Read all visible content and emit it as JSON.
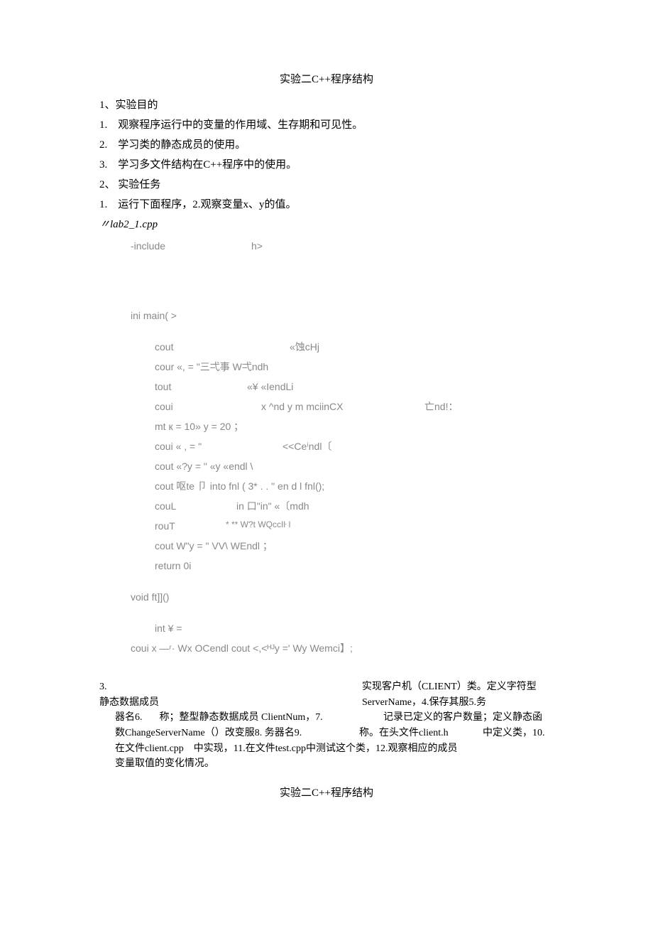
{
  "title": "实验二C++程序结构",
  "intro": {
    "h1": "1、实验目的",
    "p1": "1.　观察程序运行中的变量的作用域、生存期和可见性。",
    "p2": "2.　学习类的静态成员的使用。",
    "p3": "3.　学习多文件结构在C++程序中的使用。",
    "h2": "2、 实验任务",
    "t1": "1.　运行下面程序，2.观察变量x、y的值。",
    "file": "〃lab2_1.cpp"
  },
  "code": {
    "l1a": "-include",
    "l1b": "h>",
    "l2": "ini main( >",
    "l3a": "cout",
    "l3b": "«蚀cHj",
    "l4": "cour «, = \"三弌事 W弌ndh",
    "l5a": "tout",
    "l5b": "«¥ «IendLi",
    "l6a": "coui",
    "l6b": "x ^nd y m mciinCX",
    "l6c": "亡nd!：",
    "l7": "mt к = 10» y = 20 ；",
    "l8a": "coui « , = \"",
    "l8b": "<<Ceⁱndl〔",
    "l9": "cout «?y = \" «y «endl \\",
    "l10": "cout 呕te 卩 into fnl ( 3* . . \" en d l fnl();",
    "l11a": "couL",
    "l11b": "in 口\"in\" «〔mdh",
    "l12a": "rouT",
    "l12b": "* ** W?t WQccIŀ l",
    "l13": "cout W\"y = \" VV\\ WEndl ；",
    "l14": "return 0i",
    "l15": "void ft]]()",
    "l16": "int ¥ =",
    "l17": "coui x —ʳ· Wx OCendl cout <,<ᴴᴶy =' Wy Wemci】;"
  },
  "sec3": {
    "row1l": "3.",
    "row1r": "实现客户机（CLIENT）类。定义字符型",
    "row2l": "静态数据成员",
    "row2r": "ServerName，4.保存其服5.务",
    "row3a": "器名6.",
    "row3b": "称；整型静态数据成员 ClientNum，7.",
    "row3c": "记录已定义的客户数量；定义静态函",
    "row4a": "数ChangeServerName（）改变服8. 务器名9.",
    "row4b": "称。在头文件client.h",
    "row4c": "中定义类，10.",
    "row5": "在文件client.cpp　中实现，11.在文件test.cpp中测试这个类，12.观察相应的成员",
    "row6": "变量取值的变化情况。"
  },
  "footer": "实验二C++程序结构"
}
